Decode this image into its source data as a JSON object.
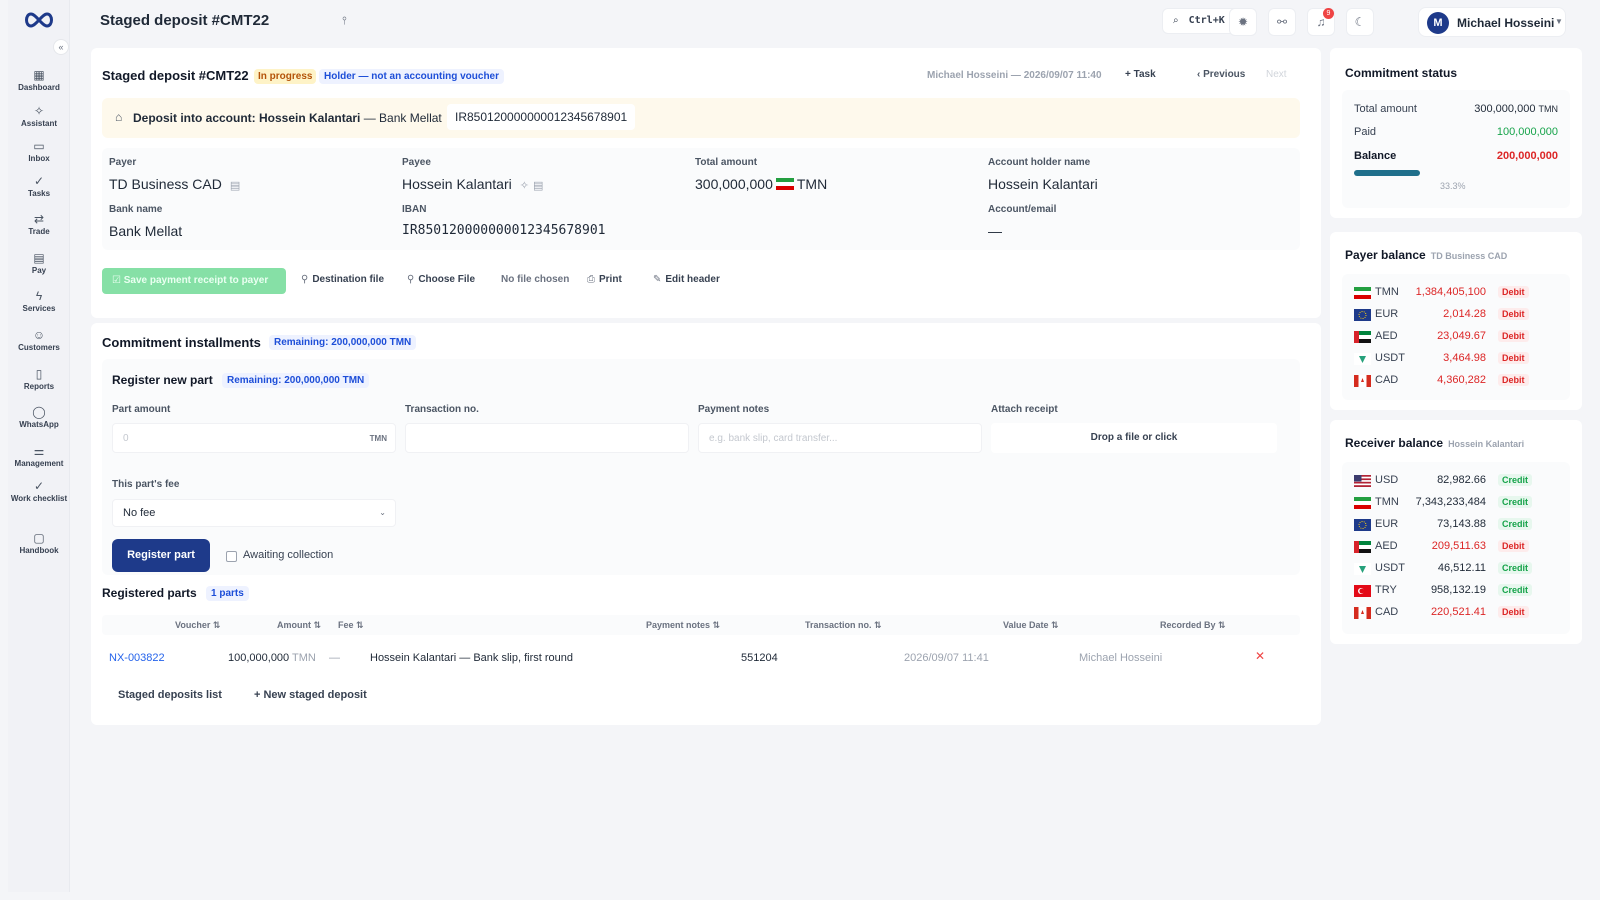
{
  "colors": {
    "accent": "#1e3a8a",
    "debit": "#dc2626",
    "credit": "#16a34a",
    "link": "#2563eb",
    "warning_bg": "#fef9ec"
  },
  "sidebar": {
    "items": [
      {
        "label": "Dashboard",
        "icon": "dashboard-icon",
        "glyph": "▦"
      },
      {
        "label": "Assistant",
        "icon": "assistant-icon",
        "glyph": "✧"
      },
      {
        "label": "Inbox",
        "icon": "inbox-icon",
        "glyph": "▭"
      },
      {
        "label": "Tasks",
        "icon": "tasks-icon",
        "glyph": "✓"
      },
      {
        "label": "Trade",
        "icon": "trade-icon",
        "glyph": "⇄"
      },
      {
        "label": "Pay",
        "icon": "pay-icon",
        "glyph": "▤"
      },
      {
        "label": "Services",
        "icon": "services-icon",
        "glyph": "ϟ"
      },
      {
        "label": "Customers",
        "icon": "customers-icon",
        "glyph": "☺"
      },
      {
        "label": "Reports",
        "icon": "reports-icon",
        "glyph": "▯"
      },
      {
        "label": "WhatsApp",
        "icon": "whatsapp-icon",
        "glyph": "◯"
      },
      {
        "label": "Management",
        "icon": "management-icon",
        "glyph": "⚌"
      },
      {
        "label": "Work checklist",
        "icon": "checklist-icon",
        "glyph": "✓"
      },
      {
        "label": "Handbook",
        "icon": "handbook-icon",
        "glyph": "▢"
      }
    ]
  },
  "header": {
    "title": "Staged deposit #CMT22",
    "search_shortcut": "Ctrl+K",
    "notification_count": "9",
    "user": {
      "initial": "M",
      "name": "Michael Hosseini"
    }
  },
  "deposit": {
    "title": "Staged deposit #CMT22",
    "status": "In progress",
    "holder_note": "Holder — not an accounting voucher",
    "author": "Michael Hosseini — 2026/09/07 11:40",
    "task_label": "+ Task",
    "previous_label": "‹ Previous",
    "next_label": "Next",
    "deposit_into_label": "Deposit into account:",
    "deposit_into_name": "Hossein Kalantari",
    "deposit_into_bank": " — Bank Mellat",
    "deposit_into_iban": "IR850120000000012345678901",
    "fields": {
      "payer_label": "Payer",
      "payer": "TD Business CAD",
      "payee_label": "Payee",
      "payee": "Hossein Kalantari",
      "total_label": "Total amount",
      "total": "300,000,000",
      "total_currency": "TMN",
      "holder_label": "Account holder name",
      "holder": "Hossein Kalantari",
      "bank_label": "Bank name",
      "bank": "Bank Mellat",
      "iban_label": "IBAN",
      "iban": "IR850120000000012345678901",
      "account_label": "Account/email",
      "account": "—"
    },
    "actions": {
      "green_button": "Save payment receipt to payer",
      "destination_file": "Destination file",
      "choose_file": "Choose File",
      "no_file": "No file chosen",
      "print": "Print",
      "edit_header": "Edit header"
    }
  },
  "installments": {
    "title": "Commitment installments",
    "remaining": "Remaining: 200,000,000 TMN",
    "register": {
      "title": "Register new part",
      "remaining": "Remaining: 200,000,000 TMN",
      "part_amount_label": "Part amount",
      "part_amount_placeholder": "0",
      "part_amount_suffix": "TMN",
      "transaction_label": "Transaction no.",
      "notes_label": "Payment notes",
      "notes_placeholder": "e.g. bank slip, card transfer...",
      "attach_label": "Attach receipt",
      "drop_text": "Drop a file or click",
      "fee_label": "This part's fee",
      "fee_value": "No fee",
      "submit": "Register part",
      "awaiting": "Awaiting collection"
    },
    "registered": {
      "title": "Registered parts",
      "count": "1 parts",
      "columns": [
        "Voucher ⇅",
        "Amount ⇅",
        "Fee ⇅",
        "Payment notes ⇅",
        "Transaction no. ⇅",
        "Value Date ⇅",
        "Recorded By ⇅"
      ],
      "rows": [
        {
          "voucher": "NX-003822",
          "amount": "100,000,000",
          "currency": "TMN",
          "fee": "—",
          "notes": "Hossein Kalantari — Bank slip, first round",
          "txn": "551204",
          "date": "2026/09/07 11:41",
          "by": "Michael Hosseini"
        }
      ]
    },
    "footer": {
      "list": "Staged deposits list",
      "new": "+ New staged deposit"
    }
  },
  "commitment_status": {
    "title": "Commitment status",
    "total_label": "Total amount",
    "total": "300,000,000",
    "total_currency": "TMN",
    "paid_label": "Paid",
    "paid": "100,000,000",
    "balance_label": "Balance",
    "balance": "200,000,000",
    "progress_fraction": 0.333,
    "progress_text": "33.3%"
  },
  "payer_balance": {
    "title": "Payer balance",
    "subtitle": "TD Business CAD",
    "rows": [
      {
        "currency": "TMN",
        "amount": "1,384,405,100",
        "type": "Debit",
        "flag": "ir"
      },
      {
        "currency": "EUR",
        "amount": "2,014.28",
        "type": "Debit",
        "flag": "eu"
      },
      {
        "currency": "AED",
        "amount": "23,049.67",
        "type": "Debit",
        "flag": "ae"
      },
      {
        "currency": "USDT",
        "amount": "3,464.98",
        "type": "Debit",
        "flag": "usdt"
      },
      {
        "currency": "CAD",
        "amount": "4,360,282",
        "type": "Debit",
        "flag": "ca"
      }
    ]
  },
  "receiver_balance": {
    "title": "Receiver balance",
    "subtitle": "Hossein Kalantari",
    "rows": [
      {
        "currency": "USD",
        "amount": "82,982.66",
        "type": "Credit",
        "flag": "us"
      },
      {
        "currency": "TMN",
        "amount": "7,343,233,484",
        "type": "Credit",
        "flag": "ir"
      },
      {
        "currency": "EUR",
        "amount": "73,143.88",
        "type": "Credit",
        "flag": "eu"
      },
      {
        "currency": "AED",
        "amount": "209,511.63",
        "type": "Debit",
        "flag": "ae"
      },
      {
        "currency": "USDT",
        "amount": "46,512.11",
        "type": "Credit",
        "flag": "usdt"
      },
      {
        "currency": "TRY",
        "amount": "958,132.19",
        "type": "Credit",
        "flag": "tr"
      },
      {
        "currency": "CAD",
        "amount": "220,521.41",
        "type": "Debit",
        "flag": "ca"
      }
    ]
  }
}
